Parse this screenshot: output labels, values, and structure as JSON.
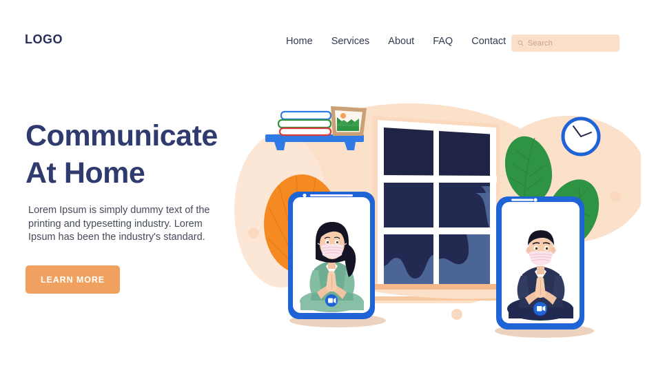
{
  "header": {
    "logo": "LOGO",
    "nav": [
      {
        "label": "Home"
      },
      {
        "label": "Services"
      },
      {
        "label": "About"
      },
      {
        "label": "FAQ"
      },
      {
        "label": "Contact"
      }
    ],
    "search": {
      "placeholder": "Search",
      "icon": "search-icon",
      "background": "#fbdfc8"
    }
  },
  "hero": {
    "heading_line1": "Communicate",
    "heading_line2": "At Home",
    "heading": "Communicate At Home",
    "body": "Lorem Ipsum is simply dummy text of the printing and typesetting industry. Lorem Ipsum has been the industry's standard.",
    "cta_label": "LEARN MORE"
  },
  "illustration": {
    "description": "Two people on video call on smartphones, meditating at home",
    "shelf": {
      "books": [
        "blue-book",
        "green-book",
        "red-book"
      ],
      "frame": "picture-frame"
    },
    "clock": {
      "time": "10:10"
    },
    "left_phone": {
      "person": "woman-with-face-mask",
      "hair": "black-ponytail",
      "shirt": "green",
      "button": "video-call-button"
    },
    "right_phone": {
      "person": "man-with-face-mask",
      "hair": "black-short",
      "shirt": "navy",
      "button": "video-call-button"
    },
    "plants": [
      "orange-fan-plant",
      "green-leaf-left",
      "green-leaf-right"
    ],
    "window": {
      "panes": 6
    }
  },
  "colors": {
    "navy": "#2f3a6e",
    "orange": "#f0a160",
    "peach": "#fbdfc8",
    "blue": "#1e64d6",
    "green": "#2e9342",
    "dark_pane": "#1f2447",
    "text": "#444a58"
  }
}
